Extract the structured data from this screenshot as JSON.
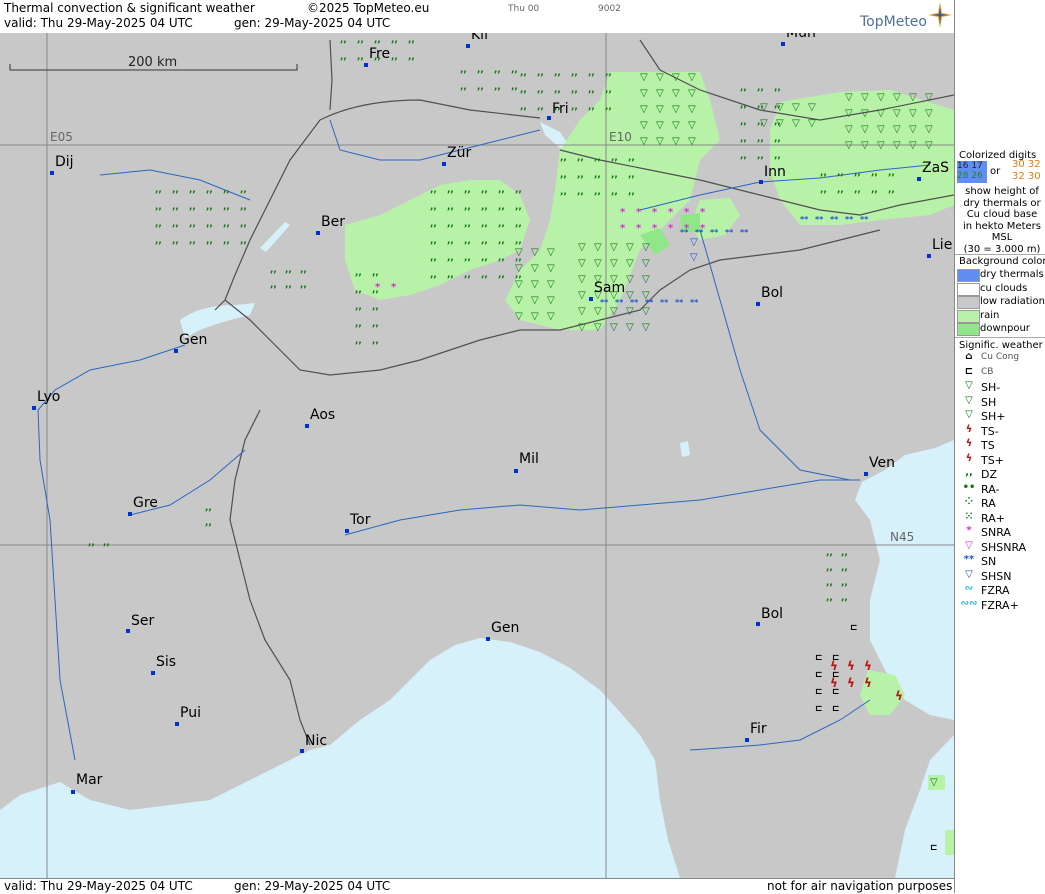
{
  "header": {
    "title": "Thermal convection & significant weather",
    "copyright": "©2025 TopMeteo.eu",
    "valid": "valid:  Thu  29-May-2025  04 UTC",
    "gen": "gen: 29-May-2025 04 UTC",
    "run": "Thu 00",
    "code": "9002",
    "logo": "TopMeteo"
  },
  "footer": {
    "valid": "valid:  Thu  29-May-2025  04 UTC",
    "gen": "gen: 29-May-2025 04 UTC",
    "note": "not for air navigation purposes"
  },
  "map": {
    "scale_label": "200 km",
    "grid_labels": [
      "E05",
      "E10",
      "N45"
    ],
    "colors": {
      "land": "#c8c8c8",
      "sea": "#d7f1fb",
      "rain": "#b8f2a8",
      "downpour": "#92e68a",
      "border": "#505050",
      "river": "#2a66c0",
      "grid": "#888888",
      "drizzle": "#117711",
      "snra": "#d030d0",
      "snow": "#2255cc",
      "ts": "#bb1111"
    },
    "cities": [
      {
        "name": "Kli",
        "dot": [
          468,
          46
        ],
        "lab": [
          471,
          39
        ]
      },
      {
        "name": "Mün",
        "dot": [
          783,
          44
        ],
        "lab": [
          786,
          37
        ]
      },
      {
        "name": "Fre",
        "dot": [
          366,
          65
        ],
        "lab": [
          369,
          58
        ]
      },
      {
        "name": "Fri",
        "dot": [
          549,
          118
        ],
        "lab": [
          552,
          113
        ]
      },
      {
        "name": "Dij",
        "dot": [
          52,
          173
        ],
        "lab": [
          55,
          166
        ]
      },
      {
        "name": "Zür",
        "dot": [
          444,
          164
        ],
        "lab": [
          447,
          157
        ]
      },
      {
        "name": "Inn",
        "dot": [
          761,
          182
        ],
        "lab": [
          764,
          176
        ]
      },
      {
        "name": "ZaS",
        "dot": [
          919,
          179
        ],
        "lab": [
          922,
          172
        ]
      },
      {
        "name": "Ber",
        "dot": [
          318,
          233
        ],
        "lab": [
          321,
          226
        ]
      },
      {
        "name": "Lie",
        "dot": [
          929,
          256
        ],
        "lab": [
          932,
          249
        ]
      },
      {
        "name": "Sam",
        "dot": [
          591,
          299
        ],
        "lab": [
          594,
          292
        ]
      },
      {
        "name": "Bol",
        "dot": [
          758,
          304
        ],
        "lab": [
          761,
          297
        ]
      },
      {
        "name": "Gen",
        "dot": [
          176,
          351
        ],
        "lab": [
          179,
          344
        ]
      },
      {
        "name": "Lyo",
        "dot": [
          34,
          408
        ],
        "lab": [
          37,
          401
        ]
      },
      {
        "name": "Aos",
        "dot": [
          307,
          426
        ],
        "lab": [
          310,
          419
        ]
      },
      {
        "name": "Mil",
        "dot": [
          516,
          471
        ],
        "lab": [
          519,
          463
        ]
      },
      {
        "name": "Ven",
        "dot": [
          866,
          474
        ],
        "lab": [
          869,
          467
        ]
      },
      {
        "name": "Gre",
        "dot": [
          130,
          514
        ],
        "lab": [
          133,
          507
        ]
      },
      {
        "name": "Tor",
        "dot": [
          347,
          531
        ],
        "lab": [
          350,
          524
        ]
      },
      {
        "name": "Bol",
        "dot": [
          758,
          624
        ],
        "lab": [
          761,
          618
        ]
      },
      {
        "name": "Ser",
        "dot": [
          128,
          631
        ],
        "lab": [
          131,
          625
        ]
      },
      {
        "name": "Gen",
        "dot": [
          488,
          639
        ],
        "lab": [
          491,
          632
        ]
      },
      {
        "name": "Sis",
        "dot": [
          153,
          673
        ],
        "lab": [
          156,
          666
        ]
      },
      {
        "name": "Pui",
        "dot": [
          177,
          724
        ],
        "lab": [
          180,
          717
        ]
      },
      {
        "name": "Fir",
        "dot": [
          747,
          740
        ],
        "lab": [
          750,
          733
        ]
      },
      {
        "name": "Nic",
        "dot": [
          302,
          751
        ],
        "lab": [
          305,
          745
        ]
      },
      {
        "name": "Mar",
        "dot": [
          73,
          792
        ],
        "lab": [
          76,
          784
        ]
      }
    ]
  },
  "legend": {
    "digits_title": "Colorized digits",
    "digits_a_top": "16 17",
    "digits_a_bot": "28 26",
    "digits_or": "or",
    "digits_b_top": "30 32",
    "digits_b_bot": "32 30",
    "digits_text": [
      "show height of",
      "dry thermals or",
      "Cu cloud base",
      "in hekto Meters",
      "MSL",
      "(30 = 3.000 m)"
    ],
    "bg_title": "Background color",
    "bg_items": [
      {
        "label": "dry thermals",
        "color": "#5f8ff0"
      },
      {
        "label": "cu clouds",
        "color": "#ffffff"
      },
      {
        "label": "low radiation",
        "color": "#c8c8c8"
      },
      {
        "label": "rain",
        "color": "#b8f2a8"
      },
      {
        "label": "downpour",
        "color": "#92e68a"
      }
    ],
    "sig_title": "Signific. weather",
    "sig_items": [
      {
        "label": "Cu Cong",
        "icon": "cu-cong-icon",
        "sym": "⌂",
        "color": "#000000"
      },
      {
        "label": "CB",
        "icon": "cb-icon",
        "sym": "⊏",
        "color": "#000000"
      },
      {
        "label": "SH-",
        "icon": "shower-light-icon",
        "sym": "▽",
        "color": "#117711"
      },
      {
        "label": "SH",
        "icon": "shower-icon",
        "sym": "▽",
        "color": "#117711"
      },
      {
        "label": "SH+",
        "icon": "shower-heavy-icon",
        "sym": "▽",
        "color": "#117711"
      },
      {
        "label": "TS-",
        "icon": "thunderstorm-light-icon",
        "sym": "ϟ",
        "color": "#bb1111"
      },
      {
        "label": "TS",
        "icon": "thunderstorm-icon",
        "sym": "ϟ",
        "color": "#bb1111"
      },
      {
        "label": "TS+",
        "icon": "thunderstorm-heavy-icon",
        "sym": "ϟ",
        "color": "#bb1111"
      },
      {
        "label": "DZ",
        "icon": "drizzle-icon",
        "sym": ",,",
        "color": "#117711"
      },
      {
        "label": "RA-",
        "icon": "rain-light-icon",
        "sym": "••",
        "color": "#117711"
      },
      {
        "label": "RA",
        "icon": "rain-icon",
        "sym": "⁘",
        "color": "#117711"
      },
      {
        "label": "RA+",
        "icon": "rain-heavy-icon",
        "sym": "⁙",
        "color": "#117711"
      },
      {
        "label": "SNRA",
        "icon": "snow-rain-icon",
        "sym": "*",
        "color": "#d030d0"
      },
      {
        "label": "SHSNRA",
        "icon": "snow-rain-shower-icon",
        "sym": "▽",
        "color": "#d030d0"
      },
      {
        "label": "SN",
        "icon": "snow-icon",
        "sym": "**",
        "color": "#2255cc"
      },
      {
        "label": "SHSN",
        "icon": "snow-shower-icon",
        "sym": "▽",
        "color": "#2255cc"
      },
      {
        "label": "FZRA",
        "icon": "freezing-rain-icon",
        "sym": "∾",
        "color": "#22bbdd"
      },
      {
        "label": "FZRA+",
        "icon": "freezing-rain-heavy-icon",
        "sym": "∾∾",
        "color": "#22bbdd"
      }
    ]
  }
}
